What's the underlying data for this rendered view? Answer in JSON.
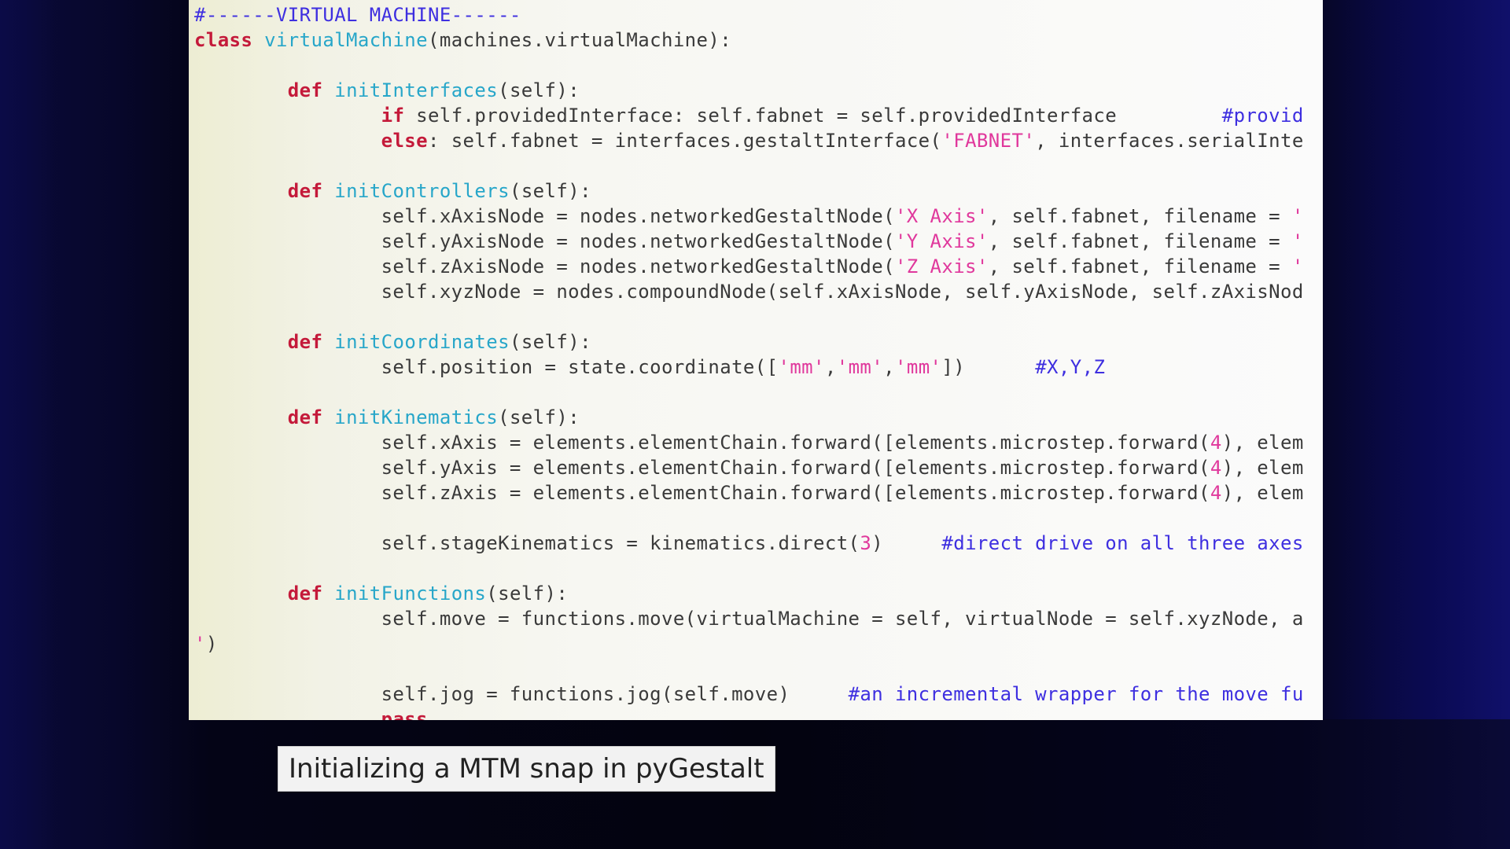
{
  "code": {
    "lines": [
      [
        {
          "t": "#------VIRTUAL MACHINE------",
          "c": "cm"
        }
      ],
      [
        {
          "t": "class",
          "c": "kw"
        },
        {
          "t": " "
        },
        {
          "t": "virtualMachine",
          "c": "fn"
        },
        {
          "t": "(machines.virtualMachine):"
        }
      ],
      [],
      [
        {
          "t": "        "
        },
        {
          "t": "def",
          "c": "kw"
        },
        {
          "t": " "
        },
        {
          "t": "initInterfaces",
          "c": "fn"
        },
        {
          "t": "(self):"
        }
      ],
      [
        {
          "t": "                "
        },
        {
          "t": "if",
          "c": "kw"
        },
        {
          "t": " self.providedInterface: self.fabnet = self.providedInterface         "
        },
        {
          "t": "#provid",
          "c": "cm"
        }
      ],
      [
        {
          "t": "                "
        },
        {
          "t": "else",
          "c": "kw"
        },
        {
          "t": ": self.fabnet = interfaces.gestaltInterface("
        },
        {
          "t": "'FABNET'",
          "c": "str"
        },
        {
          "t": ", interfaces.serialInte"
        }
      ],
      [],
      [
        {
          "t": "        "
        },
        {
          "t": "def",
          "c": "kw"
        },
        {
          "t": " "
        },
        {
          "t": "initControllers",
          "c": "fn"
        },
        {
          "t": "(self):"
        }
      ],
      [
        {
          "t": "                self.xAxisNode = nodes.networkedGestaltNode("
        },
        {
          "t": "'X Axis'",
          "c": "str"
        },
        {
          "t": ", self.fabnet, filename = "
        },
        {
          "t": "'",
          "c": "str"
        }
      ],
      [
        {
          "t": "                self.yAxisNode = nodes.networkedGestaltNode("
        },
        {
          "t": "'Y Axis'",
          "c": "str"
        },
        {
          "t": ", self.fabnet, filename = "
        },
        {
          "t": "'",
          "c": "str"
        }
      ],
      [
        {
          "t": "                self.zAxisNode = nodes.networkedGestaltNode("
        },
        {
          "t": "'Z Axis'",
          "c": "str"
        },
        {
          "t": ", self.fabnet, filename = "
        },
        {
          "t": "'",
          "c": "str"
        }
      ],
      [
        {
          "t": "                self.xyzNode = nodes.compoundNode(self.xAxisNode, self.yAxisNode, self.zAxisNod"
        }
      ],
      [],
      [
        {
          "t": "        "
        },
        {
          "t": "def",
          "c": "kw"
        },
        {
          "t": " "
        },
        {
          "t": "initCoordinates",
          "c": "fn"
        },
        {
          "t": "(self):"
        }
      ],
      [
        {
          "t": "                self.position = state.coordinate(["
        },
        {
          "t": "'mm'",
          "c": "str"
        },
        {
          "t": ","
        },
        {
          "t": "'mm'",
          "c": "str"
        },
        {
          "t": ","
        },
        {
          "t": "'mm'",
          "c": "str"
        },
        {
          "t": "])      "
        },
        {
          "t": "#X,Y,Z",
          "c": "cm"
        }
      ],
      [],
      [
        {
          "t": "        "
        },
        {
          "t": "def",
          "c": "kw"
        },
        {
          "t": " "
        },
        {
          "t": "initKinematics",
          "c": "fn"
        },
        {
          "t": "(self):"
        }
      ],
      [
        {
          "t": "                self.xAxis = elements.elementChain.forward([elements.microstep.forward("
        },
        {
          "t": "4",
          "c": "num"
        },
        {
          "t": "), elem"
        }
      ],
      [
        {
          "t": "                self.yAxis = elements.elementChain.forward([elements.microstep.forward("
        },
        {
          "t": "4",
          "c": "num"
        },
        {
          "t": "), elem"
        }
      ],
      [
        {
          "t": "                self.zAxis = elements.elementChain.forward([elements.microstep.forward("
        },
        {
          "t": "4",
          "c": "num"
        },
        {
          "t": "), elem"
        }
      ],
      [],
      [
        {
          "t": "                self.stageKinematics = kinematics.direct("
        },
        {
          "t": "3",
          "c": "num"
        },
        {
          "t": ")     "
        },
        {
          "t": "#direct drive on all three axes",
          "c": "cm"
        }
      ],
      [],
      [
        {
          "t": "        "
        },
        {
          "t": "def",
          "c": "kw"
        },
        {
          "t": " "
        },
        {
          "t": "initFunctions",
          "c": "fn"
        },
        {
          "t": "(self):"
        }
      ],
      [
        {
          "t": "                self.move = functions.move(virtualMachine = self, virtualNode = self.xyzNode, a"
        }
      ],
      [
        {
          "t": "'",
          "c": "str"
        },
        {
          "t": ")"
        }
      ],
      [],
      [
        {
          "t": "                self.jog = functions.jog(self.move)     "
        },
        {
          "t": "#an incremental wrapper for the move fu",
          "c": "cm"
        }
      ],
      [
        {
          "t": "                "
        },
        {
          "t": "pass",
          "c": "kw"
        }
      ]
    ]
  },
  "caption": {
    "text": "Initializing a MTM snap in pyGestalt"
  }
}
